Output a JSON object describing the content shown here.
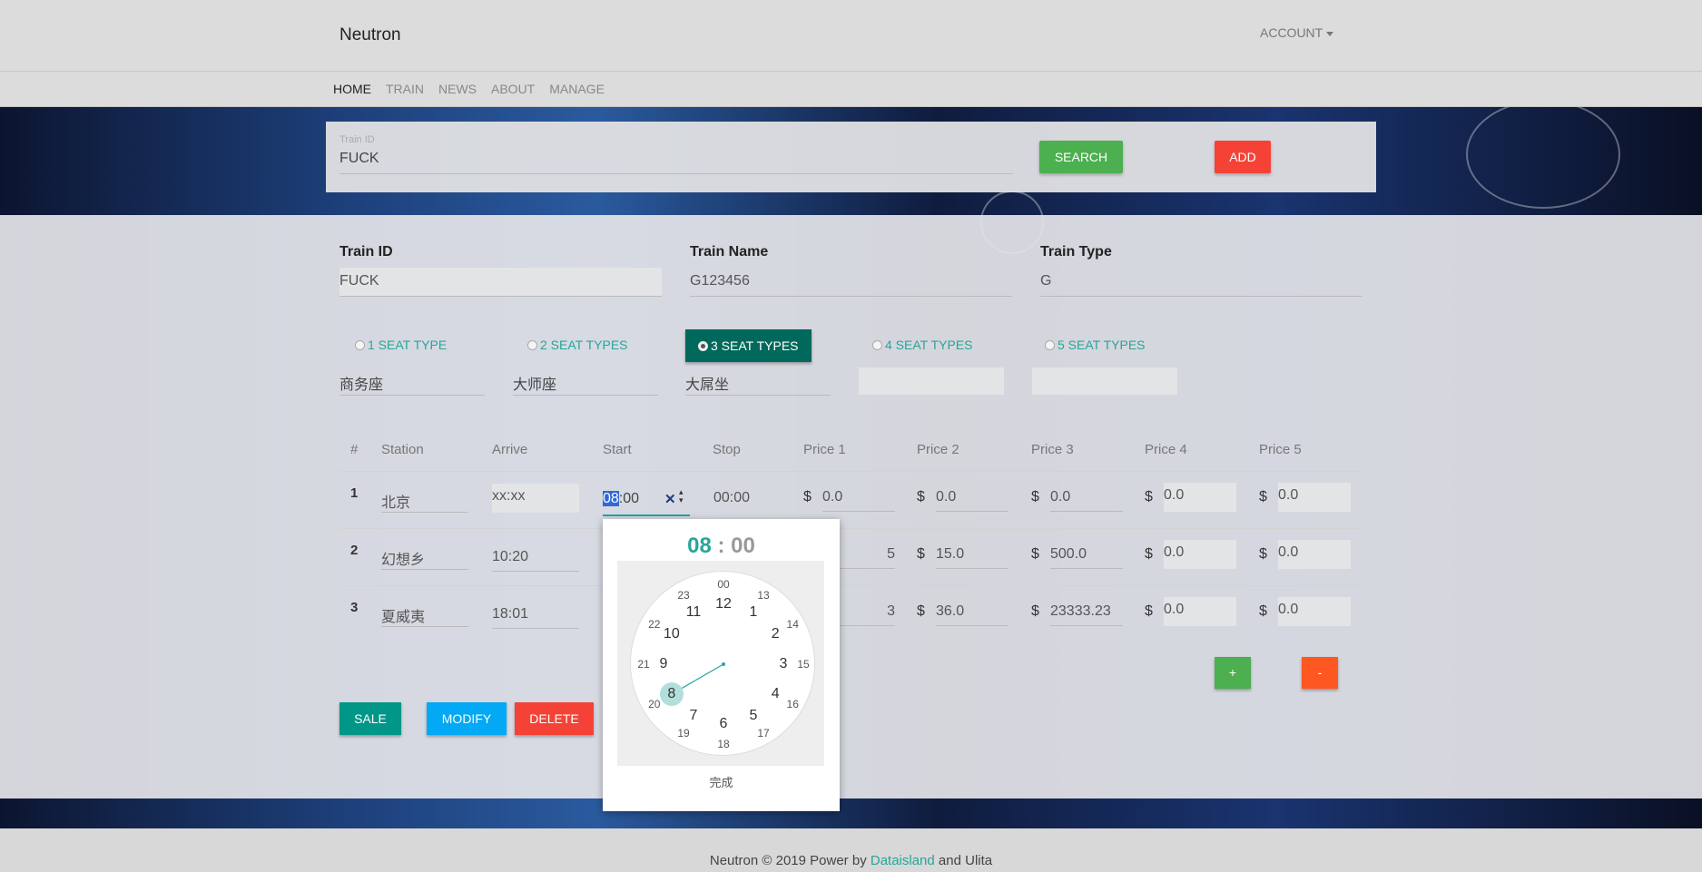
{
  "header": {
    "brand": "Neutron",
    "account": "ACCOUNT"
  },
  "nav": [
    "HOME",
    "TRAIN",
    "NEWS",
    "ABOUT",
    "MANAGE"
  ],
  "search": {
    "label": "Train ID",
    "value": "FUCK",
    "search_btn": "SEARCH",
    "add_btn": "ADD"
  },
  "form": {
    "train_id_label": "Train ID",
    "train_id": "FUCK",
    "train_name_label": "Train Name",
    "train_name": "G123456",
    "train_type_label": "Train Type",
    "train_type": "G"
  },
  "seat_options": [
    "1 SEAT TYPE",
    "2 SEAT TYPES",
    "3 SEAT TYPES",
    "4 SEAT TYPES",
    "5 SEAT TYPES"
  ],
  "seat_selected": "3 SEAT TYPES",
  "seat_names": [
    "商务座",
    "大师座",
    "大屌坐",
    "",
    ""
  ],
  "table": {
    "headers": [
      "#",
      "Station",
      "Arrive",
      "Start",
      "Stop",
      "Price 1",
      "Price 2",
      "Price 3",
      "Price 4",
      "Price 5"
    ],
    "rows": [
      {
        "num": "1",
        "station": "北京",
        "arrive": "xx:xx",
        "start": "08:00",
        "stop": "00:00",
        "p1": "0.0",
        "p2": "0.0",
        "p3": "0.0",
        "p4": "0.0",
        "p5": "0.0"
      },
      {
        "num": "2",
        "station": "幻想乡",
        "arrive": "10:20",
        "start": "",
        "stop": "",
        "p1": "5",
        "p2": "15.0",
        "p3": "500.0",
        "p4": "0.0",
        "p5": "0.0"
      },
      {
        "num": "3",
        "station": "夏威夷",
        "arrive": "18:01",
        "start": "",
        "stop": "",
        "p1": "3",
        "p2": "36.0",
        "p3": "23333.23",
        "p4": "0.0",
        "p5": "0.0"
      }
    ],
    "currency": "$",
    "add_row": "+",
    "remove_row": "-"
  },
  "time_input": {
    "hour": "08",
    "rest": ":00",
    "clear": "✕",
    "spin": "▴▾"
  },
  "actions": {
    "sale": "SALE",
    "modify": "MODIFY",
    "delete": "DELETE"
  },
  "clock": {
    "hour": "08",
    "sep": ":",
    "minute": "00",
    "outer": [
      "12",
      "1",
      "2",
      "3",
      "4",
      "5",
      "6",
      "7",
      "8",
      "9",
      "10",
      "11"
    ],
    "inner": [
      "00",
      "13",
      "14",
      "15",
      "16",
      "17",
      "18",
      "19",
      "20",
      "21",
      "22",
      "23"
    ],
    "selected_hour": 8,
    "done": "完成"
  },
  "footer": {
    "prefix": "Neutron © 2019 Power by ",
    "link": "Dataisland",
    "suffix": " and Ulita"
  },
  "colors": {
    "teal": "#26a69a",
    "dark_teal": "#00695c",
    "green": "#4caf50",
    "red": "#f44336",
    "blue": "#03a9f4",
    "orange": "#ff5722"
  }
}
